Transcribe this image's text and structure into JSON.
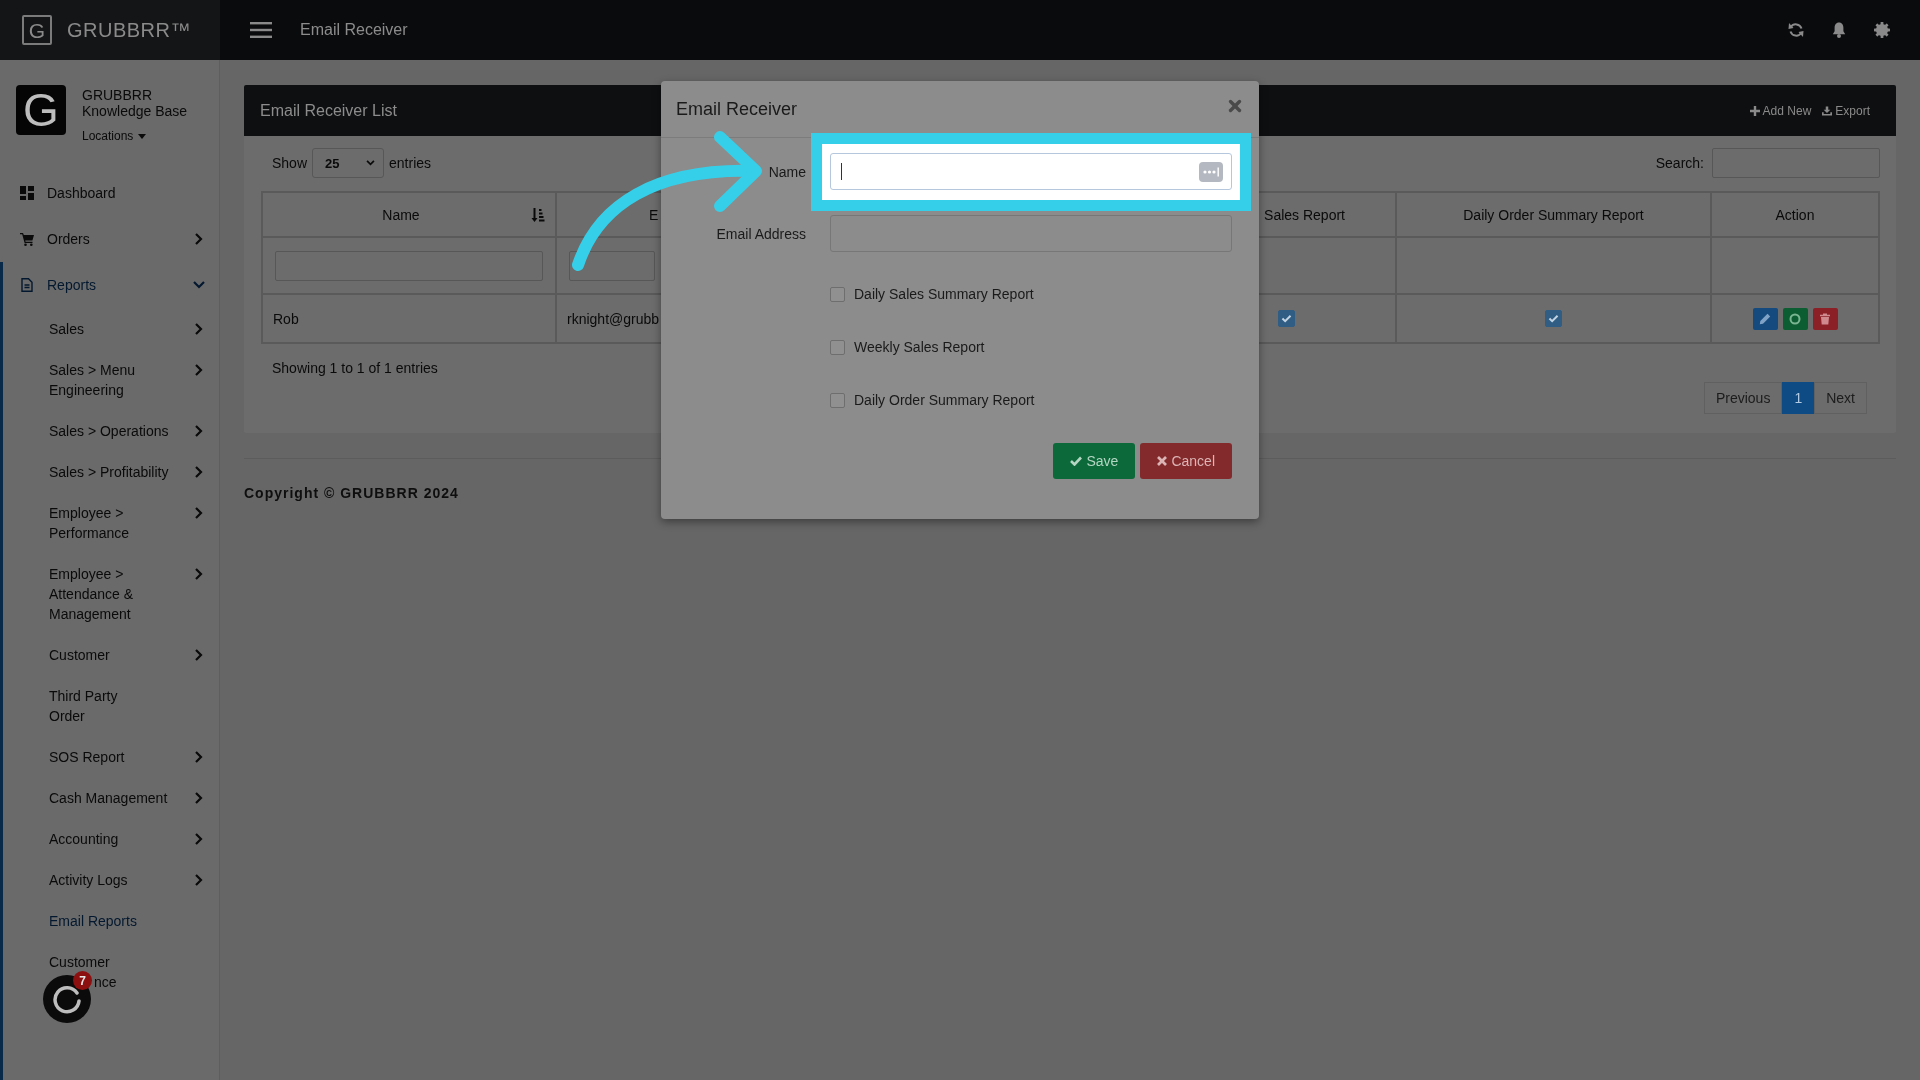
{
  "topbar": {
    "brand": {
      "mark": "G",
      "name": "GRUBBRR™"
    },
    "page_title": "Email Receiver"
  },
  "sidebar": {
    "profile": {
      "mark": "G",
      "name": "GRUBBRR",
      "subtitle": "Knowledge Base",
      "location_menu": "Locations"
    },
    "items": [
      {
        "label": "Dashboard",
        "selected": false,
        "expandable": false,
        "expanded": false
      },
      {
        "label": "Orders",
        "selected": false,
        "expandable": true,
        "expanded": false
      },
      {
        "label": "Reports",
        "selected": true,
        "expandable": true,
        "expanded": true,
        "children": [
          {
            "label": "Sales",
            "selected": false,
            "expandable": true
          },
          {
            "label": "Sales > Menu Engineering",
            "selected": false,
            "expandable": true
          },
          {
            "label": "Sales > Operations",
            "selected": false,
            "expandable": true
          },
          {
            "label": "Sales > Profitability",
            "selected": false,
            "expandable": true
          },
          {
            "label": "Employee > Performance",
            "selected": false,
            "expandable": true
          },
          {
            "label": "Employee > Attendance & Management",
            "selected": false,
            "expandable": true
          },
          {
            "label": "Customer",
            "selected": false,
            "expandable": true
          },
          {
            "label": "Third Party Order",
            "selected": false,
            "expandable": false
          },
          {
            "label": "SOS Report",
            "selected": false,
            "expandable": true
          },
          {
            "label": "Cash Management",
            "selected": false,
            "expandable": true
          },
          {
            "label": "Accounting",
            "selected": false,
            "expandable": true
          },
          {
            "label": "Activity Logs",
            "selected": false,
            "expandable": true
          },
          {
            "label": "Email Reports",
            "selected": true,
            "expandable": false
          },
          {
            "label": "Customer",
            "label_line_2": "nce",
            "selected": false,
            "expandable": false
          }
        ]
      }
    ]
  },
  "chat_widget": {
    "badge": "7"
  },
  "card": {
    "title": "Email Receiver List",
    "actions": [
      {
        "kind": "add",
        "label": "Add New"
      },
      {
        "kind": "export",
        "label": "Export"
      }
    ],
    "length_menu": {
      "prefix": "Show",
      "value": "25",
      "suffix": "entries"
    },
    "search": {
      "label": "Search:"
    },
    "table": {
      "columns": [
        {
          "label": "Name",
          "sorted": true,
          "filter": true
        },
        {
          "label": "E",
          "sorted": false,
          "filter": true
        },
        {
          "label": "Sales Report",
          "sorted": false,
          "filter": false
        },
        {
          "label": "Daily Order Summary Report",
          "sorted": false,
          "filter": false
        },
        {
          "label": "Action",
          "sorted": false,
          "filter": false
        }
      ],
      "rows": [
        {
          "cells": [
            {
              "kind": "text",
              "text": "Rob"
            },
            {
              "kind": "text",
              "text": "rknight@grubb"
            },
            {
              "kind": "check",
              "checked": true
            },
            {
              "kind": "check",
              "checked": true
            },
            {
              "kind": "actions",
              "buttons": [
                {
                  "kind": "edit"
                },
                {
                  "kind": "status"
                },
                {
                  "kind": "delete"
                }
              ]
            }
          ]
        }
      ]
    },
    "info": "Showing 1 to 1 of 1 entries",
    "pagination": [
      {
        "label": "Previous",
        "selected": false,
        "disabled": true
      },
      {
        "label": "1",
        "selected": true,
        "disabled": false
      },
      {
        "label": "Next",
        "selected": false,
        "disabled": true
      }
    ]
  },
  "copyright": "Copyright © GRUBBRR 2024",
  "modal": {
    "title": "Email Receiver",
    "fields": [
      {
        "label": "Name",
        "highlighted": true,
        "focused": true,
        "autofill_icon": true
      },
      {
        "label": "Email Address",
        "highlighted": false,
        "focused": false,
        "autofill_icon": false
      }
    ],
    "checkboxes": [
      {
        "label": "Daily Sales Summary Report",
        "checked": false
      },
      {
        "label": "Weekly Sales Report",
        "checked": false
      },
      {
        "label": "Daily Order Summary Report",
        "checked": false
      }
    ],
    "buttons": [
      {
        "kind": "save",
        "label": "Save"
      },
      {
        "kind": "cancel",
        "label": "Cancel"
      }
    ]
  },
  "annotation": {
    "arrow": true
  }
}
